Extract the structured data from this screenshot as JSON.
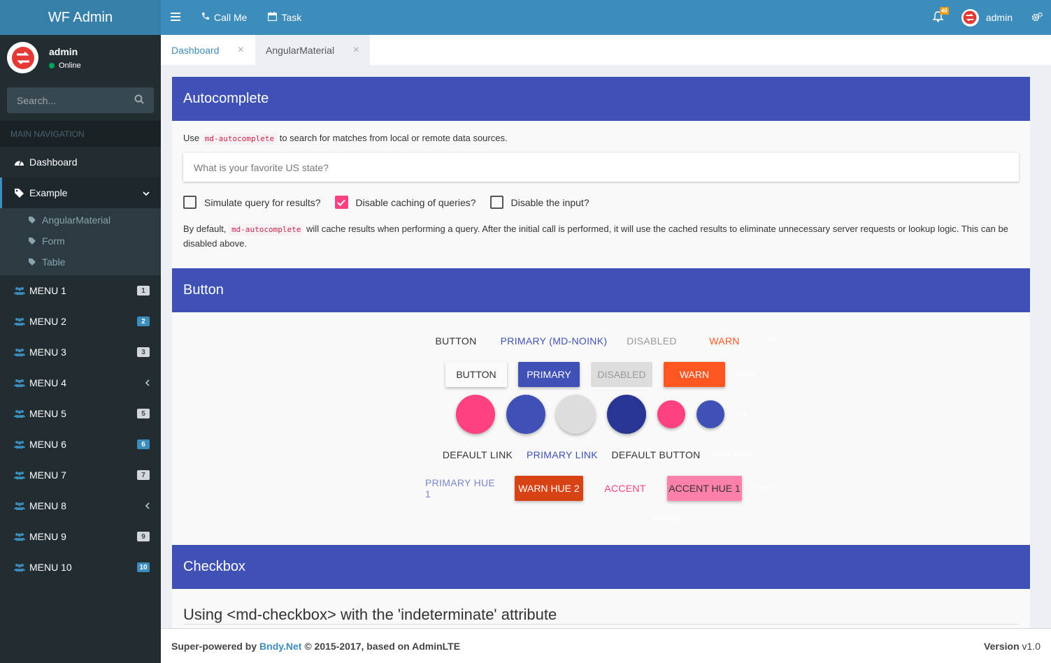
{
  "app": {
    "logo": "WF Admin"
  },
  "user_panel": {
    "name": "admin",
    "status": "Online"
  },
  "search": {
    "placeholder": "Search..."
  },
  "nav": {
    "header": "MAIN NAVIGATION",
    "dashboard": "Dashboard",
    "example": "Example",
    "sub_items": [
      "AngularMaterial",
      "Form",
      "Table"
    ],
    "menus": [
      {
        "label": "MENU 1",
        "badge": "1"
      },
      {
        "label": "MENU 2",
        "badge": "2"
      },
      {
        "label": "MENU 3",
        "badge": "3"
      },
      {
        "label": "MENU 4",
        "badge": ""
      },
      {
        "label": "MENU 5",
        "badge": "5"
      },
      {
        "label": "MENU 6",
        "badge": "6"
      },
      {
        "label": "MENU 7",
        "badge": "7"
      },
      {
        "label": "MENU 8",
        "badge": ""
      },
      {
        "label": "MENU 9",
        "badge": "9"
      },
      {
        "label": "MENU 10",
        "badge": "10"
      }
    ]
  },
  "header": {
    "call_me": "Call Me",
    "task": "Task",
    "notif_count": "40",
    "user": "admin"
  },
  "tabs": [
    {
      "label": "Dashboard"
    },
    {
      "label": "AngularMaterial"
    }
  ],
  "autocomplete": {
    "title": "Autocomplete",
    "desc_pre": "Use",
    "desc_code": "md-autocomplete",
    "desc_post": "to search for matches from local or remote data sources.",
    "placeholder": "What is your favorite US state?",
    "checkboxes": [
      {
        "label": "Simulate query for results?",
        "checked": false
      },
      {
        "label": "Disable caching of queries?",
        "checked": true
      },
      {
        "label": "Disable the input?",
        "checked": false
      }
    ],
    "note_pre": "By default,",
    "note_code": "md-autocomplete",
    "note_post": "will cache results when performing a query. After the initial call is performed, it will use the cached results to eliminate unnecessary server requests or lookup logic. This can be disabled above."
  },
  "button_section": {
    "title": "Button",
    "flat": [
      "BUTTON",
      "PRIMARY (MD-NOINK)",
      "DISABLED",
      "WARN"
    ],
    "flat_hint": "Flat",
    "raised": [
      "BUTTON",
      "PRIMARY",
      "DISABLED",
      "WARN"
    ],
    "raised_hint": "Raised",
    "fab_hint": "FAB",
    "links": [
      "DEFAULT LINK",
      "PRIMARY LINK",
      "DEFAULT BUTTON"
    ],
    "links_hint": "Link vs. Button",
    "themed": [
      "PRIMARY HUE 1",
      "WARN HUE 2",
      "ACCENT",
      "ACCENT HUE 1"
    ],
    "themed_hint": "Themed",
    "icon_hint": "Icon Button"
  },
  "checkbox_section": {
    "title": "Checkbox",
    "heading": "Using <md-checkbox> with the 'indeterminate' attribute"
  },
  "footer": {
    "prefix": "Super-powered by",
    "link": "Bndy.Net",
    "suffix": "© 2015-2017, based on AdminLTE",
    "version_label": "Version",
    "version": "v1.0"
  },
  "colors": {
    "primary": "#3f51b5",
    "accent": "#ff4081",
    "warn": "#ff5722",
    "header": "#3c8dbc",
    "sidebar": "#222d32"
  }
}
